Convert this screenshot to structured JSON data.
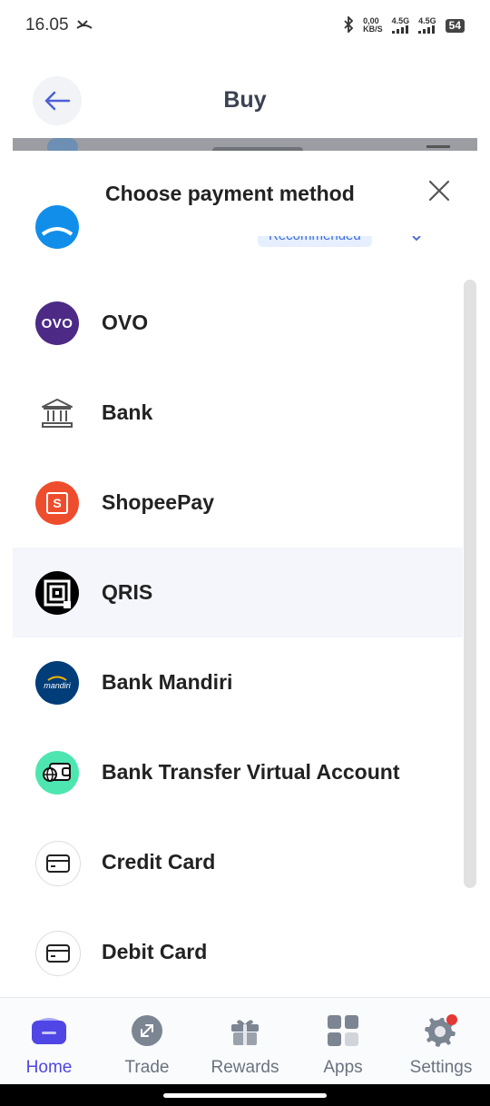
{
  "status_bar": {
    "time": "16.05",
    "net_speed_value": "0,00",
    "net_speed_unit": "KB/S",
    "signal1": "4.5G",
    "signal2": "4.5G",
    "battery": "54"
  },
  "header": {
    "title": "Buy"
  },
  "sheet": {
    "title": "Choose payment method",
    "partial_item": {
      "label": "Dana",
      "badge": "Recommended"
    },
    "items": [
      {
        "label": "OVO",
        "icon": "ovo-logo",
        "selected": false
      },
      {
        "label": "Bank",
        "icon": "bank-building-icon",
        "selected": false
      },
      {
        "label": "ShopeePay",
        "icon": "shopeepay-logo",
        "selected": false
      },
      {
        "label": "QRIS",
        "icon": "qris-logo",
        "selected": true
      },
      {
        "label": "Bank Mandiri",
        "icon": "mandiri-logo",
        "selected": false
      },
      {
        "label": "Bank Transfer Virtual Account",
        "icon": "virtual-account-icon",
        "selected": false
      },
      {
        "label": "Credit Card",
        "icon": "card-icon",
        "selected": false
      },
      {
        "label": "Debit Card",
        "icon": "card-icon",
        "selected": false
      }
    ],
    "ovo_logo_text": "OVO",
    "shopeepay_logo_text": "S",
    "mandiri_logo_text": "mandiri"
  },
  "bottom_nav": [
    {
      "label": "Home",
      "active": true
    },
    {
      "label": "Trade",
      "active": false
    },
    {
      "label": "Rewards",
      "active": false
    },
    {
      "label": "Apps",
      "active": false
    },
    {
      "label": "Settings",
      "active": false
    }
  ],
  "colors": {
    "accent": "#4f46e5",
    "ovo": "#4c2a86",
    "shopeepay": "#ee4d2d",
    "mandiri": "#003d79",
    "dana": "#118eea",
    "va_green": "#4ee6b0"
  }
}
